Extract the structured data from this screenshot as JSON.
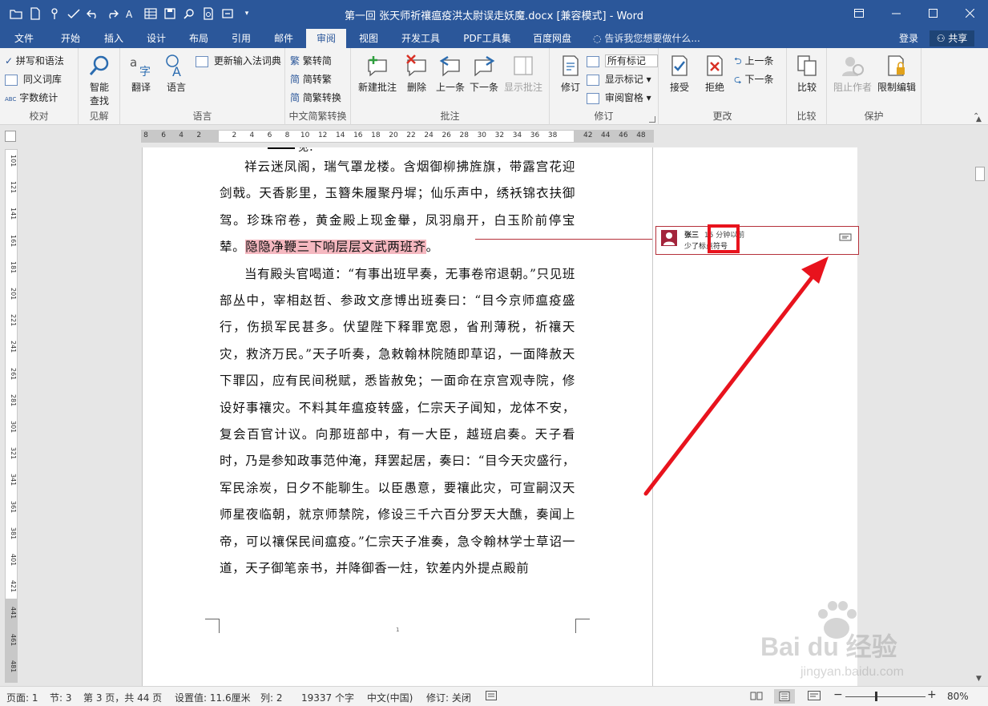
{
  "window": {
    "title": "第一回 张天师祈禳瘟疫洪太尉误走妖魔.docx [兼容模式] - Word",
    "controls": [
      "restore-ribbon",
      "minimize",
      "maximize",
      "close"
    ]
  },
  "tabs": [
    {
      "label": "文件",
      "active": false
    },
    {
      "label": "开始",
      "active": false
    },
    {
      "label": "插入",
      "active": false
    },
    {
      "label": "设计",
      "active": false
    },
    {
      "label": "布局",
      "active": false
    },
    {
      "label": "引用",
      "active": false
    },
    {
      "label": "邮件",
      "active": false
    },
    {
      "label": "审阅",
      "active": true
    },
    {
      "label": "视图",
      "active": false
    },
    {
      "label": "开发工具",
      "active": false
    },
    {
      "label": "PDF工具集",
      "active": false
    },
    {
      "label": "百度网盘",
      "active": false
    }
  ],
  "tell_me": "告诉我您想要做什么...",
  "account": {
    "login": "登录",
    "share": "共享"
  },
  "ribbon": {
    "proofing": {
      "spell": "拼写和语法",
      "thesaurus": "同义词库",
      "wordcount": "字数统计",
      "label": "校对"
    },
    "insights": {
      "smart_lookup": "智能\n查找",
      "smart_lookup_1": "智能",
      "smart_lookup_2": "查找",
      "label": "见解"
    },
    "language": {
      "translate": "翻译",
      "language": "语言",
      "update_ime": "更新输入法词典",
      "label": "语言"
    },
    "chinese": {
      "to_trad": "繁转简",
      "to_simp": "简转繁",
      "convert": "简繁转换",
      "label": "中文简繁转换"
    },
    "comments": {
      "new": "新建批注",
      "delete": "删除",
      "prev": "上一条",
      "next": "下一条",
      "show": "显示批注",
      "label": "批注"
    },
    "tracking": {
      "track": "修订",
      "markup": "所有标记",
      "show_markup": "显示标记",
      "pane": "审阅窗格",
      "label": "修订"
    },
    "changes": {
      "accept": "接受",
      "reject": "拒绝",
      "prev": "上一条",
      "next": "下一条",
      "label": "更改"
    },
    "compare": {
      "compare": "比较",
      "label": "比较"
    },
    "protect": {
      "block": "阻止作者",
      "restrict": "限制编辑",
      "label": "保护"
    }
  },
  "ruler": {
    "h_numbers": [
      "8",
      "6",
      "4",
      "2",
      "2",
      "4",
      "6",
      "8",
      "10",
      "12",
      "14",
      "16",
      "18",
      "20",
      "22",
      "24",
      "26",
      "28",
      "30",
      "32",
      "34",
      "36",
      "38",
      "42",
      "44",
      "46",
      "48"
    ],
    "v_numbers": [
      "101",
      "121",
      "141",
      "161",
      "181",
      "201",
      "221",
      "241",
      "261",
      "281",
      "301",
      "321",
      "341",
      "361",
      "381",
      "401",
      "421",
      "441",
      "461",
      "481"
    ]
  },
  "document": {
    "top_fragment": "见：",
    "paragraphs": [
      {
        "before": "祥云迷凤阁，瑞气罩龙楼。含烟御柳拂旌旗，带露宫花迎剑戟。天香影里，玉簪朱履聚丹墀；仙乐声中，绣袄锦衣扶御驾。珍珠帘卷，黄金殿上现金轝，凤羽扇开，白玉阶前停宝辇。",
        "highlight": "隐隐净鞭三下响层层文武两班齐",
        "after": "。"
      },
      {
        "before": "当有殿头官喝道：“有事出班早奏，无事卷帘退朝。”只见班部丛中，宰相赵哲、参政文彦博出班奏曰：“目今京师瘟疫盛行，伤损军民甚多。伏望陛下释罪宽恩，省刑薄税，祈禳天灾，救济万民。”天子听奏，急敕翰林院随即草诏，一面降赦天下罪囚，应有民间税赋，悉皆赦免；一面命在京宫观寺院，修设好事禳灾。不料其年瘟疫转盛，仁宗天子闻知，龙体不安，复会百官计议。向那班部中，有一大臣，越班启奏。天子看时，乃是参知政事范仲淹，拜罢起居，奏曰：“目今天灾盛行，军民涂炭，日夕不能聊生。以臣愚意，要禳此灾，可宣嗣汉天师星夜临朝，就京师禁院，修设三千六百分罗天大醮，奏闻上帝，可以禳保民间瘟疫。”仁宗天子准奏，急令翰林学士草诏一道，天子御笔亲书，并降御香一炷，钦差内外提点殿前",
        "highlight": "",
        "after": ""
      }
    ],
    "page_number": "1"
  },
  "comment": {
    "author": "张三",
    "time": "15 分钟以前",
    "text": "少了标点符号",
    "avatar_color": "#a3243b",
    "border_color": "#b5303a"
  },
  "annotation": {
    "color": "#e8131d"
  },
  "status": {
    "page": "页面: 1",
    "section": "节: 3",
    "pages": "第 3 页，共 44 页",
    "position": "设置值: 11.6厘米",
    "column": "列: 2",
    "words": "19337 个字",
    "language": "中文(中国)",
    "track": "修订: 关闭",
    "zoom": "80%"
  },
  "watermark": {
    "brand": "Bai du 经验",
    "url": "jingyan.baidu.com"
  },
  "colors": {
    "brand": "#2b579a",
    "highlight": "#f5b8c0"
  }
}
